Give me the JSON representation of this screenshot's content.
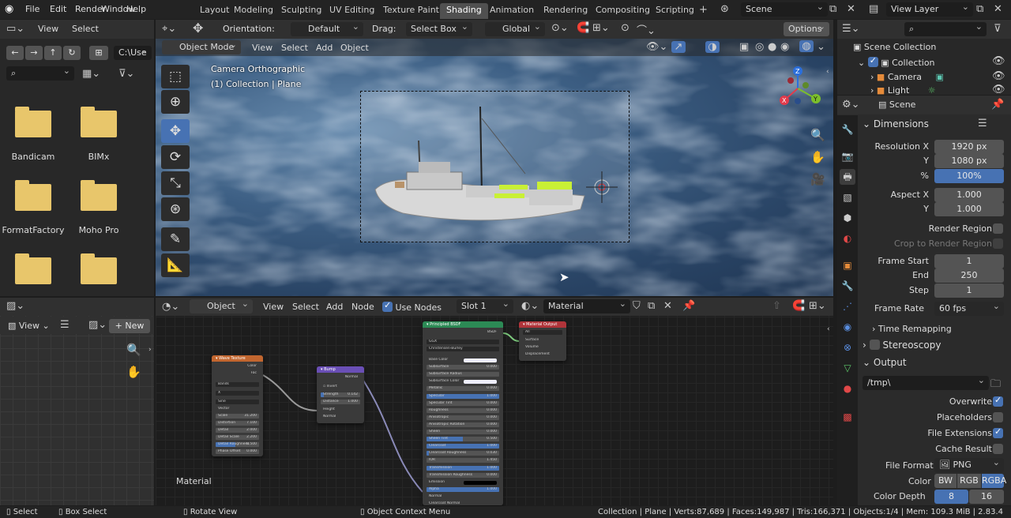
{
  "menu": [
    "File",
    "Edit",
    "Render",
    "Window",
    "Help"
  ],
  "workspaces": [
    "Layout",
    "Modeling",
    "Sculpting",
    "UV Editing",
    "Texture Paint",
    "Shading",
    "Animation",
    "Rendering",
    "Compositing",
    "Scripting"
  ],
  "active_workspace": "Shading",
  "scene": "Scene",
  "view_layer": "View Layer",
  "file_browser": {
    "view": "View",
    "select": "Select",
    "path": "C:\\Use",
    "folders": [
      "Bandicam",
      "BIMx",
      "FormatFactory",
      "Moho Pro",
      "",
      ""
    ]
  },
  "viewport": {
    "orientation_label": "Orientation:",
    "orientation": "Default",
    "drag_label": "Drag:",
    "drag": "Select Box",
    "transform": "Global",
    "options": "Options",
    "mode": "Object Mode",
    "menus": [
      "View",
      "Select",
      "Add",
      "Object"
    ],
    "camera_label": "Camera Orthographic",
    "collection_label": "(1) Collection | Plane",
    "gizmo": {
      "x": "X",
      "y": "Y",
      "z": "Z"
    }
  },
  "outliner": {
    "root": "Scene Collection",
    "items": [
      "Collection",
      "Camera",
      "Light"
    ]
  },
  "properties": {
    "scene": "Scene",
    "dimensions": {
      "title": "Dimensions",
      "res_x_label": "Resolution X",
      "res_x": "1920 px",
      "res_y_label": "Y",
      "res_y": "1080 px",
      "pct_label": "%",
      "pct": "100%",
      "aspect_x_label": "Aspect X",
      "aspect_x": "1.000",
      "aspect_y_label": "Y",
      "aspect_y": "1.000",
      "render_region": "Render Region",
      "crop": "Crop to Render Region",
      "frame_start_label": "Frame Start",
      "frame_start": "1",
      "end_label": "End",
      "end": "250",
      "step_label": "Step",
      "step": "1",
      "frame_rate_label": "Frame Rate",
      "frame_rate": "60 fps",
      "time_remapping": "Time Remapping"
    },
    "stereoscopy": "Stereoscopy",
    "output": {
      "title": "Output",
      "path": "/tmp\\",
      "overwrite": "Overwrite",
      "placeholders": "Placeholders",
      "file_extensions": "File Extensions",
      "cache_result": "Cache Result",
      "file_format_label": "File Format",
      "file_format": "PNG",
      "color_label": "Color",
      "color_opts": [
        "BW",
        "RGB",
        "RGBA"
      ],
      "color_depth_label": "Color Depth",
      "depth_opts": [
        "8",
        "16"
      ]
    }
  },
  "node_editor": {
    "mode": "Object",
    "menus": [
      "View",
      "Select",
      "Add",
      "Node"
    ],
    "use_nodes": "Use Nodes",
    "slot": "Slot 1",
    "material": "Material",
    "label": "Material",
    "wave": {
      "title": "Wave Texture",
      "outputs": [
        "Color",
        "Fac"
      ],
      "dropdowns": [
        "Bands",
        "X",
        "Sine"
      ],
      "vector": "Vector",
      "fields": [
        [
          "Scale",
          "31.200"
        ],
        [
          "Distortion",
          "7.100"
        ],
        [
          "Detail",
          "2.000"
        ],
        [
          "Detail Scale",
          "2.200"
        ],
        [
          "Detail Roughness",
          "0.500"
        ],
        [
          "Phase Offset",
          "0.000"
        ]
      ]
    },
    "bump": {
      "title": "Bump",
      "output": "Normal",
      "invert": "Invert",
      "fields": [
        [
          "Strength",
          "0.142"
        ],
        [
          "Distance",
          "1.000"
        ]
      ],
      "inputs": [
        "Height",
        "Normal"
      ]
    },
    "bsdf": {
      "title": "Principled BSDF",
      "output": "BSDF",
      "dropdowns": [
        "GGX",
        "Christensen-Burley"
      ],
      "rows": [
        [
          "Base Color",
          ""
        ],
        [
          "Subsurface",
          "0.000"
        ],
        [
          "Subsurface Radius",
          ""
        ],
        [
          "Subsurface Color",
          ""
        ],
        [
          "Metallic",
          "0.000"
        ],
        [
          "Specular",
          "1.000"
        ],
        [
          "Specular Tint",
          "0.000"
        ],
        [
          "Roughness",
          "0.000"
        ],
        [
          "Anisotropic",
          "0.000"
        ],
        [
          "Anisotropic Rotation",
          "0.000"
        ],
        [
          "Sheen",
          "0.000"
        ],
        [
          "Sheen Tint",
          "0.500"
        ],
        [
          "Clearcoat",
          "1.000"
        ],
        [
          "Clearcoat Roughness",
          "0.030"
        ],
        [
          "IOR",
          "1.450"
        ],
        [
          "Transmission",
          "1.000"
        ],
        [
          "Transmission Roughness",
          "0.000"
        ],
        [
          "Emission",
          ""
        ],
        [
          "Alpha",
          "1.000"
        ],
        [
          "Normal",
          ""
        ],
        [
          "Clearcoat Normal",
          ""
        ]
      ]
    },
    "output": {
      "title": "Material Output",
      "target": "All",
      "inputs": [
        "Surface",
        "Volume",
        "Displacement"
      ]
    }
  },
  "image_editor": {
    "view": "View",
    "new": "New"
  },
  "status": {
    "select": "Select",
    "box_select": "Box Select",
    "rotate": "Rotate View",
    "context": "Object Context Menu",
    "stats": "Collection | Plane | Verts:87,689 | Faces:149,987 | Tris:166,371 | Objects:1/4 | Mem: 109.3 MiB | 2.83.4"
  },
  "colors": {
    "accent": "#4772b3",
    "wave_header": "#c2662f",
    "bump_header": "#6a4fb6",
    "bsdf_header": "#2c8a55",
    "output_header": "#b0343a",
    "folder": "#e8c66b"
  }
}
